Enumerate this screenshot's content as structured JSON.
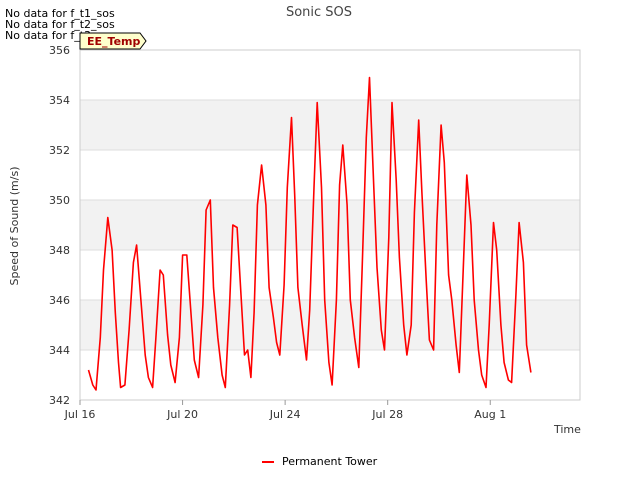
{
  "no_data_messages": [
    "No data for f_t1_sos",
    "No data for f_t2_sos",
    "No data for f_t3_sos"
  ],
  "tag_label": "EE_Temp",
  "colors": {
    "series": "#ff0000",
    "band": "#f2f2f2",
    "grid": "#dddddd",
    "tag_bg": "#ffffcc"
  },
  "chart_data": {
    "type": "line",
    "title": "Sonic SOS",
    "xlabel": "Time",
    "ylabel": "Speed of Sound (m/s)",
    "ylim": [
      342,
      356
    ],
    "yticks": [
      342,
      344,
      346,
      348,
      350,
      352,
      354,
      356
    ],
    "xlim": [
      "2024-07-16",
      "2024-08-04"
    ],
    "xticks": [
      {
        "date": "2024-07-16",
        "label": "Jul 16"
      },
      {
        "date": "2024-07-20",
        "label": "Jul 20"
      },
      {
        "date": "2024-07-24",
        "label": "Jul 24"
      },
      {
        "date": "2024-07-28",
        "label": "Jul 28"
      },
      {
        "date": "2024-08-01",
        "label": "Aug 1"
      }
    ],
    "legend_position": "bottom-center",
    "series": [
      {
        "name": "Permanent Tower",
        "color": "#ff0000",
        "points": [
          [
            "2024-07-16T08:00",
            343.2
          ],
          [
            "2024-07-16T12:00",
            342.6
          ],
          [
            "2024-07-16T15:00",
            342.4
          ],
          [
            "2024-07-16T19:00",
            344.5
          ],
          [
            "2024-07-16T22:00",
            347.2
          ],
          [
            "2024-07-17T02:00",
            349.3
          ],
          [
            "2024-07-17T06:00",
            348.0
          ],
          [
            "2024-07-17T09:00",
            345.5
          ],
          [
            "2024-07-17T12:00",
            343.5
          ],
          [
            "2024-07-17T14:00",
            342.5
          ],
          [
            "2024-07-17T18:00",
            342.6
          ],
          [
            "2024-07-17T22:00",
            344.8
          ],
          [
            "2024-07-18T02:00",
            347.5
          ],
          [
            "2024-07-18T05:00",
            348.2
          ],
          [
            "2024-07-18T09:00",
            346.0
          ],
          [
            "2024-07-18T13:00",
            343.8
          ],
          [
            "2024-07-18T16:00",
            342.9
          ],
          [
            "2024-07-18T20:00",
            342.5
          ],
          [
            "2024-07-18T23:00",
            344.5
          ],
          [
            "2024-07-19T03:00",
            347.2
          ],
          [
            "2024-07-19T06:00",
            347.0
          ],
          [
            "2024-07-19T10:00",
            344.6
          ],
          [
            "2024-07-19T13:00",
            343.4
          ],
          [
            "2024-07-19T17:00",
            342.7
          ],
          [
            "2024-07-19T21:00",
            344.5
          ],
          [
            "2024-07-20T00:00",
            347.8
          ],
          [
            "2024-07-20T04:00",
            347.8
          ],
          [
            "2024-07-20T08:00",
            345.4
          ],
          [
            "2024-07-20T11:00",
            343.6
          ],
          [
            "2024-07-20T15:00",
            342.9
          ],
          [
            "2024-07-20T19:00",
            345.8
          ],
          [
            "2024-07-20T22:00",
            349.6
          ],
          [
            "2024-07-21T02:00",
            350.0
          ],
          [
            "2024-07-21T05:00",
            346.5
          ],
          [
            "2024-07-21T09:00",
            344.5
          ],
          [
            "2024-07-21T13:00",
            343.0
          ],
          [
            "2024-07-21T16:00",
            342.5
          ],
          [
            "2024-07-21T20:00",
            345.8
          ],
          [
            "2024-07-21T23:00",
            349.0
          ],
          [
            "2024-07-22T03:00",
            348.9
          ],
          [
            "2024-07-22T07:00",
            346.0
          ],
          [
            "2024-07-22T10:00",
            343.8
          ],
          [
            "2024-07-22T13:00",
            344.0
          ],
          [
            "2024-07-22T16:00",
            342.9
          ],
          [
            "2024-07-22T19:00",
            345.5
          ],
          [
            "2024-07-22T22:00",
            349.8
          ],
          [
            "2024-07-23T02:00",
            351.4
          ],
          [
            "2024-07-23T06:00",
            349.8
          ],
          [
            "2024-07-23T09:00",
            346.5
          ],
          [
            "2024-07-23T13:00",
            345.3
          ],
          [
            "2024-07-23T16:00",
            344.3
          ],
          [
            "2024-07-23T19:00",
            343.8
          ],
          [
            "2024-07-23T23:00",
            346.6
          ],
          [
            "2024-07-24T02:00",
            350.5
          ],
          [
            "2024-07-24T06:00",
            353.3
          ],
          [
            "2024-07-24T09:00",
            350.2
          ],
          [
            "2024-07-24T12:00",
            346.5
          ],
          [
            "2024-07-24T16:00",
            345.0
          ],
          [
            "2024-07-24T20:00",
            343.6
          ],
          [
            "2024-07-24T23:00",
            345.6
          ],
          [
            "2024-07-25T03:00",
            350.5
          ],
          [
            "2024-07-25T06:00",
            353.9
          ],
          [
            "2024-07-25T10:00",
            350.5
          ],
          [
            "2024-07-25T13:00",
            346.0
          ],
          [
            "2024-07-25T17:00",
            343.5
          ],
          [
            "2024-07-25T20:00",
            342.6
          ],
          [
            "2024-07-26T00:00",
            346.0
          ],
          [
            "2024-07-26T03:00",
            350.6
          ],
          [
            "2024-07-26T06:00",
            352.2
          ],
          [
            "2024-07-26T10:00",
            349.8
          ],
          [
            "2024-07-26T13:00",
            346.0
          ],
          [
            "2024-07-26T17:00",
            344.5
          ],
          [
            "2024-07-26T21:00",
            343.3
          ],
          [
            "2024-07-27T00:00",
            347.2
          ],
          [
            "2024-07-27T04:00",
            352.5
          ],
          [
            "2024-07-27T07:00",
            354.9
          ],
          [
            "2024-07-27T11:00",
            350.5
          ],
          [
            "2024-07-27T14:00",
            347.3
          ],
          [
            "2024-07-27T18:00",
            344.8
          ],
          [
            "2024-07-27T21:00",
            344.0
          ],
          [
            "2024-07-28T01:00",
            348.5
          ],
          [
            "2024-07-28T04:00",
            353.9
          ],
          [
            "2024-07-28T08:00",
            350.8
          ],
          [
            "2024-07-28T11:00",
            347.7
          ],
          [
            "2024-07-28T15:00",
            345.0
          ],
          [
            "2024-07-28T18:00",
            343.8
          ],
          [
            "2024-07-28T22:00",
            345.0
          ],
          [
            "2024-07-29T01:00",
            349.5
          ],
          [
            "2024-07-29T05:00",
            353.2
          ],
          [
            "2024-07-29T08:00",
            350.3
          ],
          [
            "2024-07-29T12:00",
            346.8
          ],
          [
            "2024-07-29T15:00",
            344.4
          ],
          [
            "2024-07-29T19:00",
            344.0
          ],
          [
            "2024-07-29T22:00",
            349.0
          ],
          [
            "2024-07-30T02:00",
            353.0
          ],
          [
            "2024-07-30T05:00",
            351.5
          ],
          [
            "2024-07-30T09:00",
            347.0
          ],
          [
            "2024-07-30T12:00",
            346.0
          ],
          [
            "2024-07-30T16:00",
            344.2
          ],
          [
            "2024-07-30T19:00",
            343.1
          ],
          [
            "2024-07-30T23:00",
            347.5
          ],
          [
            "2024-07-31T02:00",
            351.0
          ],
          [
            "2024-07-31T06:00",
            349.0
          ],
          [
            "2024-07-31T09:00",
            346.0
          ],
          [
            "2024-07-31T13:00",
            344.0
          ],
          [
            "2024-07-31T16:00",
            343.0
          ],
          [
            "2024-07-31T20:00",
            342.5
          ],
          [
            "2024-07-31T23:00",
            345.0
          ],
          [
            "2024-08-01T03:00",
            349.1
          ],
          [
            "2024-08-01T06:00",
            348.0
          ],
          [
            "2024-08-01T10:00",
            345.0
          ],
          [
            "2024-08-01T13:00",
            343.5
          ],
          [
            "2024-08-01T17:00",
            342.8
          ],
          [
            "2024-08-01T20:00",
            342.7
          ],
          [
            "2024-08-02T00:00",
            346.2
          ],
          [
            "2024-08-02T03:00",
            349.1
          ],
          [
            "2024-08-02T07:00",
            347.5
          ],
          [
            "2024-08-02T10:00",
            344.2
          ],
          [
            "2024-08-02T14:00",
            343.1
          ]
        ]
      }
    ]
  }
}
